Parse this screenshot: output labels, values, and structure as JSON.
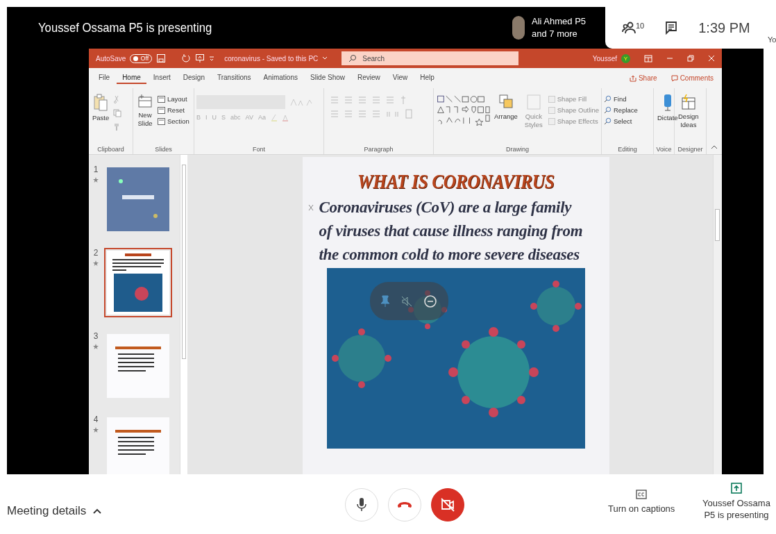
{
  "meet": {
    "presenter_banner": "Youssef Ossama P5 is presenting",
    "participants": {
      "name": "Ali Ahmed P5",
      "more": "and 7 more"
    },
    "people_count": "10",
    "time": "1:39 PM",
    "side_label": "Yo"
  },
  "powerpoint": {
    "autosave": {
      "label": "AutoSave",
      "toggle_text": "Off",
      "on": false
    },
    "document_title": "coronavirus - Saved to this PC",
    "search": {
      "placeholder": "Search"
    },
    "user": {
      "name": "Youssef",
      "initial": "Y"
    },
    "tabs": [
      {
        "label": "File",
        "selected": false
      },
      {
        "label": "Home",
        "selected": true
      },
      {
        "label": "Insert",
        "selected": false
      },
      {
        "label": "Design",
        "selected": false
      },
      {
        "label": "Transitions",
        "selected": false
      },
      {
        "label": "Animations",
        "selected": false
      },
      {
        "label": "Slide Show",
        "selected": false
      },
      {
        "label": "Review",
        "selected": false
      },
      {
        "label": "View",
        "selected": false
      },
      {
        "label": "Help",
        "selected": false
      }
    ],
    "share": "Share",
    "comments": "Comments",
    "ribbon": {
      "clipboard": {
        "label": "Clipboard",
        "paste": "Paste"
      },
      "slides": {
        "label": "Slides",
        "new_slide": [
          "New",
          "Slide"
        ],
        "items": [
          "Layout",
          "Reset",
          "Section"
        ]
      },
      "font": {
        "label": "Font",
        "buttons": [
          "B",
          "I",
          "U",
          "S",
          "abc",
          "AV",
          "Aa"
        ]
      },
      "paragraph": {
        "label": "Paragraph"
      },
      "drawing": {
        "label": "Drawing",
        "arrange": "Arrange",
        "quick_styles": {
          "label": "Quick Styles",
          "disabled": true
        },
        "items": [
          {
            "label": "Shape Fill",
            "disabled": true
          },
          {
            "label": "Shape Outline",
            "disabled": true
          },
          {
            "label": "Shape Effects",
            "disabled": true
          }
        ]
      },
      "editing": {
        "label": "Editing",
        "items": [
          "Find",
          "Replace",
          "Select"
        ]
      },
      "voice": {
        "label": "Voice",
        "dictate": "Dictate"
      },
      "designer": {
        "label": "Designer",
        "design_ideas": [
          "Design",
          "Ideas"
        ]
      }
    },
    "slides": [
      {
        "number": "1",
        "kind": "title",
        "selected": false
      },
      {
        "number": "2",
        "kind": "image",
        "selected": true
      },
      {
        "number": "3",
        "kind": "text",
        "selected": false
      },
      {
        "number": "4",
        "kind": "text",
        "selected": false
      }
    ],
    "current_slide": {
      "title": "WHAT IS CORONAVIRUS",
      "bullet": "Coronaviruses (CoV) are a large family of viruses that cause illness ranging from the common cold to more severe diseases"
    }
  },
  "controls": {
    "meeting_details": "Meeting details",
    "mic_on": true,
    "camera_on": false,
    "captions": "Turn on captions",
    "presenting": "Youssef Ossama P5 is presenting"
  }
}
